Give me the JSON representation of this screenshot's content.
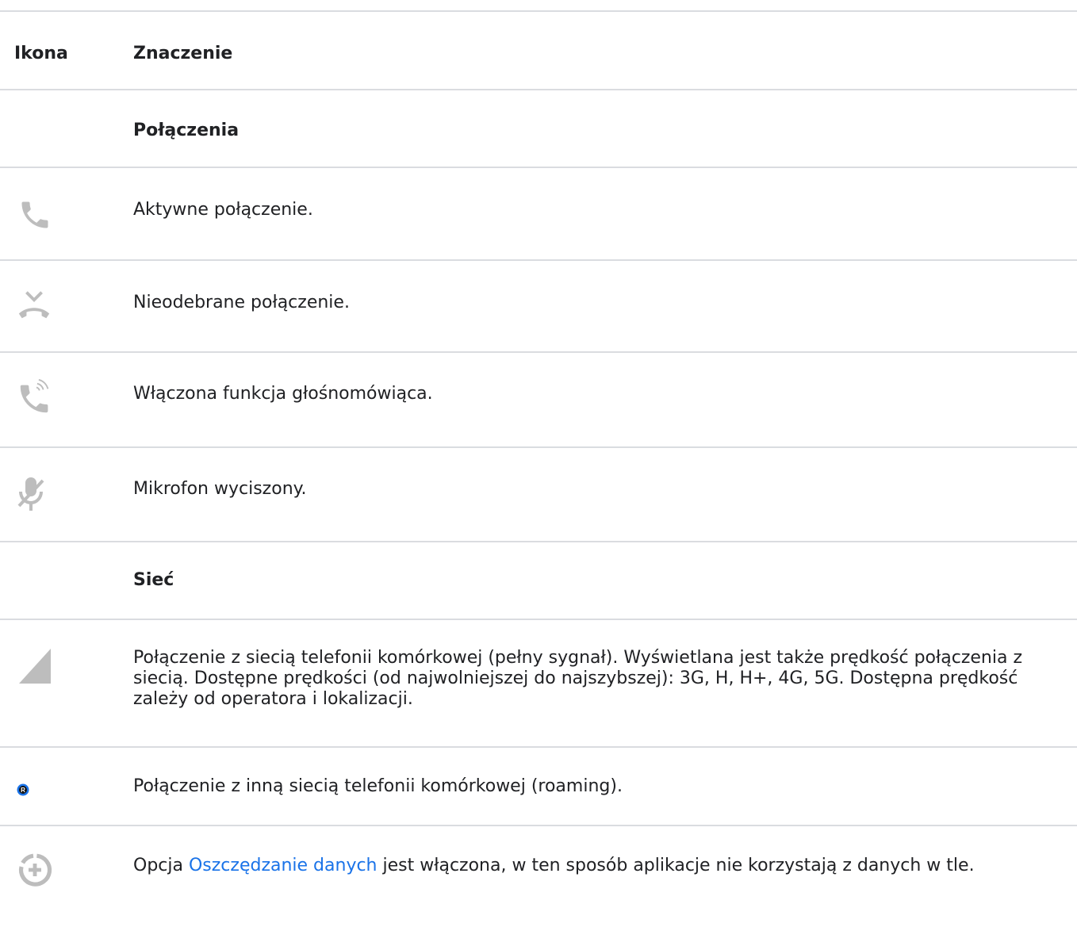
{
  "header": {
    "icon_col": "Ikona",
    "meaning_col": "Znaczenie"
  },
  "sections": {
    "calls": "Połączenia",
    "network": "Sieć"
  },
  "rows": {
    "active_call": {
      "icon": "phone-icon",
      "text": "Aktywne połączenie."
    },
    "missed_call": {
      "icon": "missed-call-icon",
      "text": "Nieodebrane połączenie."
    },
    "speakerphone": {
      "icon": "speakerphone-icon",
      "text": "Włączona funkcja głośnomówiąca."
    },
    "mic_muted": {
      "icon": "mic-off-icon",
      "text": "Mikrofon wyciszony."
    },
    "signal_full": {
      "icon": "signal-full-icon",
      "text": "Połączenie z siecią telefonii komórkowej (pełny sygnał). Wyświetlana jest także prędkość połączenia z siecią. Dostępne prędkości (od najwolniejszej do najszybszej): 3G, H, H+, 4G, 5G. Dostępna prędkość zależy od operatora i lokalizacji."
    },
    "roaming": {
      "icon": "roaming-icon",
      "badge": "R",
      "text": "Połączenie z inną siecią telefonii komórkowej (roaming)."
    },
    "data_saver": {
      "icon": "data-saver-icon",
      "text_before": "Opcja ",
      "link": "Oszczędzanie danych",
      "text_after": " jest włączona, w ten sposób aplikacje nie korzystają z danych w tle."
    }
  },
  "colors": {
    "icon_gray": "#bdbdbd",
    "link": "#1a73e8",
    "roaming_badge": "#1a73e8",
    "divider": "#dadce0"
  }
}
